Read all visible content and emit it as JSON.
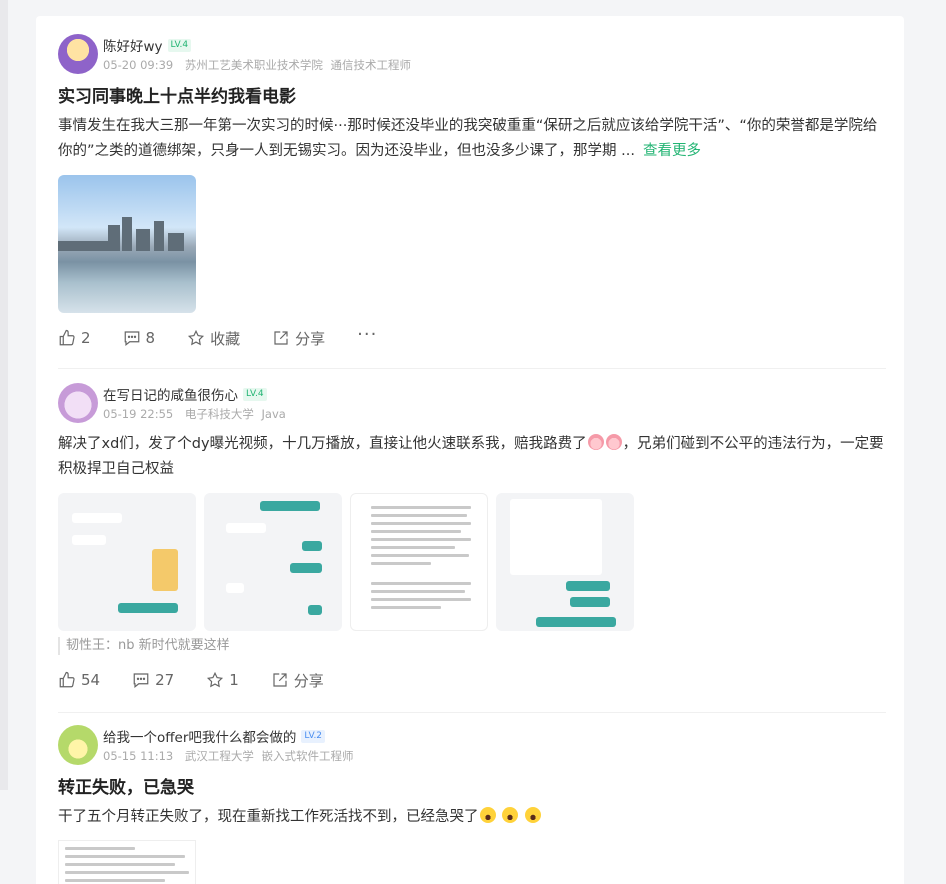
{
  "posts": [
    {
      "author": "陈好好wy",
      "level": "LV.4",
      "time": "05-20 09:39",
      "school": "苏州工艺美术职业技术学院",
      "role": "通信技术工程师",
      "title": "实习同事晚上十点半约我看电影",
      "body": "事情发生在我大三那一年第一次实习的时候···那时候还没毕业的我突破重重“保研之后就应该给学院干活”、“你的荣誉都是学院给你的”之类的道德绑架，只身一人到无锡实习。因为还没毕业，但也没多少课了，那学期 ...",
      "more": "查看更多",
      "likes": "2",
      "comments": "8",
      "favorite": "收藏",
      "share": "分享"
    },
    {
      "author": "在写日记的咸鱼很伤心",
      "level": "LV.4",
      "time": "05-19 22:55",
      "school": "电子科技大学",
      "role": "Java",
      "body_a": "解决了xd们，发了个dy曝光视频，十几万播放，直接让他火速联系我，赔我路费了",
      "body_b": "，兄弟们碰到不公平的违法行为，一定要积极捍卫自己权益",
      "comment": "韧性王：nb 新时代就要这样",
      "likes": "54",
      "comments": "27",
      "favorite": "1",
      "share": "分享"
    },
    {
      "author": "给我一个offer吧我什么都会做的",
      "level": "LV.2",
      "time": "05-15 11:13",
      "school": "武汉工程大学",
      "role": "嵌入式软件工程师",
      "title": "转正失败，已急哭",
      "body": "干了五个月转正失败了，现在重新找工作死活找不到，已经急哭了"
    }
  ],
  "icons": {
    "like": "thumbs-up-icon",
    "comment": "comment-icon",
    "favorite": "star-icon",
    "share": "share-icon",
    "more": "more-icon"
  },
  "colors": {
    "accent": "#22b473",
    "level_blue": "#4a8ef0"
  }
}
